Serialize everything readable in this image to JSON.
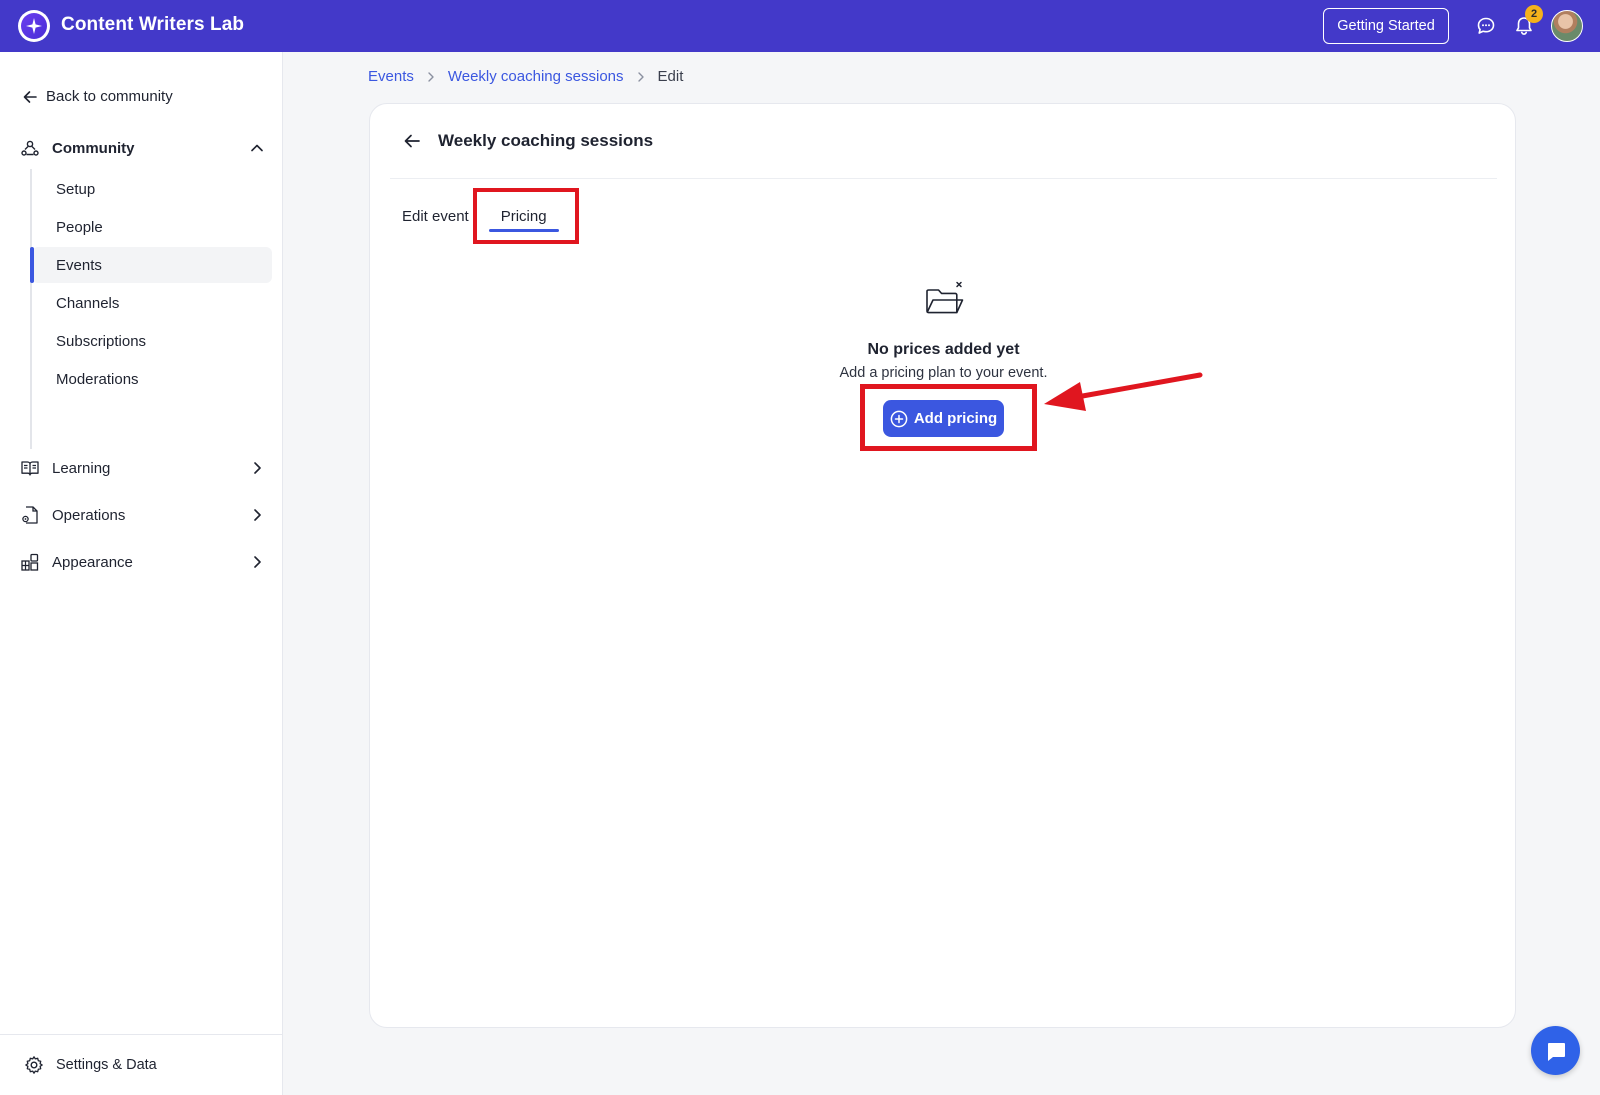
{
  "app": {
    "title": "Content Writers Lab"
  },
  "header": {
    "getting_started_label": "Getting Started",
    "notification_count": "2",
    "accent_color": "#4339c9"
  },
  "sidebar": {
    "back_label": "Back to community",
    "community": {
      "label": "Community",
      "expanded": true,
      "items": [
        {
          "label": "Setup",
          "active": false
        },
        {
          "label": "People",
          "active": false
        },
        {
          "label": "Events",
          "active": true
        },
        {
          "label": "Channels",
          "active": false
        },
        {
          "label": "Subscriptions",
          "active": false
        },
        {
          "label": "Moderations",
          "active": false
        }
      ]
    },
    "sections": [
      {
        "label": "Learning",
        "icon": "book-icon"
      },
      {
        "label": "Operations",
        "icon": "document-gear-icon"
      },
      {
        "label": "Appearance",
        "icon": "widgets-icon"
      }
    ],
    "settings_label": "Settings & Data"
  },
  "breadcrumb": {
    "items": [
      "Events",
      "Weekly coaching sessions"
    ],
    "current": "Edit"
  },
  "card": {
    "title": "Weekly coaching sessions",
    "tabs": [
      {
        "label": "Edit event",
        "active": false
      },
      {
        "label": "Pricing",
        "active": true
      }
    ],
    "empty_state": {
      "title": "No prices added yet",
      "description": "Add a pricing plan to your event.",
      "button_label": "Add pricing"
    }
  },
  "annotation_color": "#e0161f",
  "primary_color": "#3b57e0"
}
